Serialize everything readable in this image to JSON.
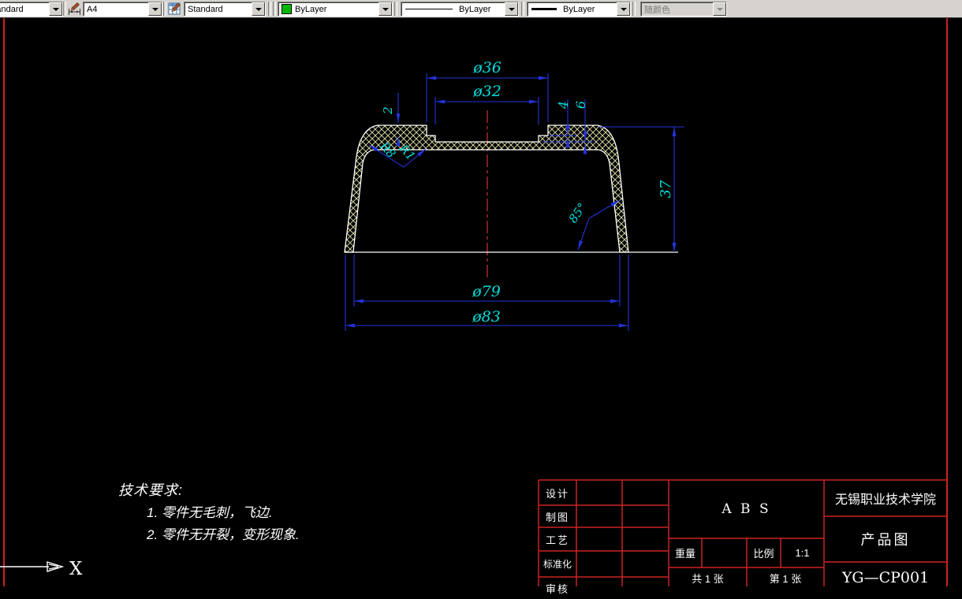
{
  "toolbar": {
    "text_style_combo": {
      "value": "Standard"
    },
    "dim_style_combo": {
      "value": "A4"
    },
    "table_style_combo": {
      "value": "Standard"
    },
    "color_combo": {
      "value": "ByLayer",
      "swatch_color": "#00b800"
    },
    "linetype_combo": {
      "value": "ByLayer"
    },
    "lineweight_combo": {
      "value": "ByLayer"
    },
    "plot_style_combo": {
      "value": "随颜色",
      "disabled": true
    }
  },
  "drawing": {
    "dims": {
      "d36": "ø36",
      "d32": "ø32",
      "t2": "2",
      "t4": "4",
      "t6": "6",
      "r8": "R8",
      "r1": "R1",
      "h37": "37",
      "a85": "85°",
      "d79": "ø79",
      "d83": "ø83"
    },
    "tech_requirements": {
      "title": "技术要求:",
      "item1": "1. 零件无毛刺，飞边.",
      "item2": "2. 零件无开裂，变形现象."
    },
    "ucs_x_label": "X",
    "colors": {
      "outline": "#ffffff",
      "hatch": "#e6e6ac",
      "dimension_lines": "#2233dd",
      "dimension_text": "#00dede",
      "centerline": "#c03030",
      "frame": "#cc2222"
    }
  },
  "title_block": {
    "left_rows": [
      {
        "label": "设计"
      },
      {
        "label": "制图"
      },
      {
        "label": "工艺"
      },
      {
        "label": "标准化"
      },
      {
        "label": "审核"
      }
    ],
    "material": "A B S",
    "weight_label": "重量",
    "scale_label": "比例",
    "scale_value": "1:1",
    "total_sheets": "共 1 张",
    "sheet_number": "第 1 张",
    "organization": "无锡职业技术学院",
    "drawing_title": "产品图",
    "drawing_number": "YG—CP001"
  }
}
